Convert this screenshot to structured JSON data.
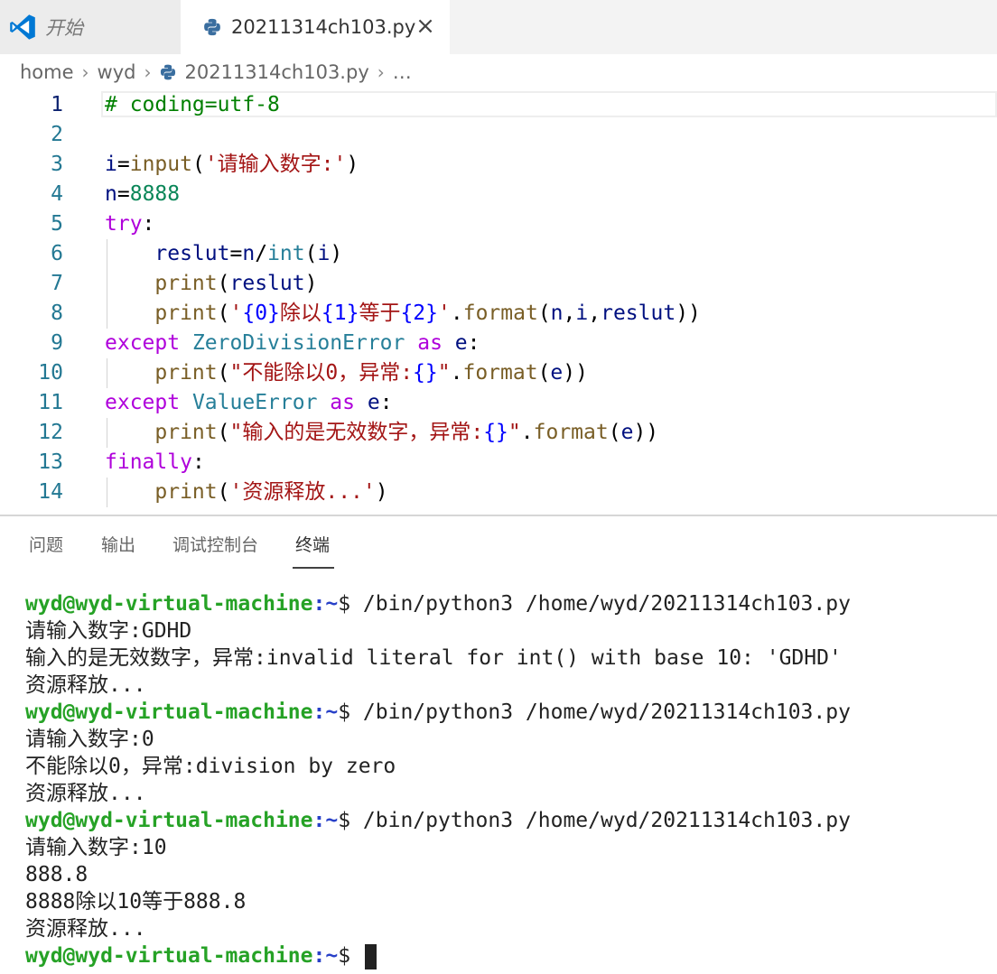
{
  "tabs": {
    "start_label": "开始",
    "file_label": "20211314ch103.py",
    "close_glyph": "×"
  },
  "breadcrumb": [
    "home",
    "wyd",
    "20211314ch103.py",
    "…"
  ],
  "editor": {
    "line_numbers": [
      "1",
      "2",
      "3",
      "4",
      "5",
      "6",
      "7",
      "8",
      "9",
      "10",
      "11",
      "12",
      "13",
      "14"
    ],
    "active_line": "1",
    "lines": [
      [
        {
          "t": "# coding=utf-8",
          "c": "cmt"
        }
      ],
      [],
      [
        {
          "t": "i",
          "c": "var"
        },
        {
          "t": "=",
          "c": "plain"
        },
        {
          "t": "input",
          "c": "fn"
        },
        {
          "t": "(",
          "c": "plain"
        },
        {
          "t": "'请输入数字:'",
          "c": "str"
        },
        {
          "t": ")",
          "c": "plain"
        }
      ],
      [
        {
          "t": "n",
          "c": "var"
        },
        {
          "t": "=",
          "c": "plain"
        },
        {
          "t": "8888",
          "c": "num"
        }
      ],
      [
        {
          "t": "try",
          "c": "kw"
        },
        {
          "t": ":",
          "c": "plain"
        }
      ],
      [
        {
          "t": "    ",
          "c": "plain"
        },
        {
          "t": "reslut",
          "c": "var"
        },
        {
          "t": "=",
          "c": "plain"
        },
        {
          "t": "n",
          "c": "var"
        },
        {
          "t": "/",
          "c": "plain"
        },
        {
          "t": "int",
          "c": "type"
        },
        {
          "t": "(",
          "c": "plain"
        },
        {
          "t": "i",
          "c": "var"
        },
        {
          "t": ")",
          "c": "plain"
        }
      ],
      [
        {
          "t": "    ",
          "c": "plain"
        },
        {
          "t": "print",
          "c": "fn"
        },
        {
          "t": "(",
          "c": "plain"
        },
        {
          "t": "reslut",
          "c": "var"
        },
        {
          "t": ")",
          "c": "plain"
        }
      ],
      [
        {
          "t": "    ",
          "c": "plain"
        },
        {
          "t": "print",
          "c": "fn"
        },
        {
          "t": "(",
          "c": "plain"
        },
        {
          "t": "'",
          "c": "str"
        },
        {
          "t": "{0}",
          "c": "brace"
        },
        {
          "t": "除以",
          "c": "str"
        },
        {
          "t": "{1}",
          "c": "brace"
        },
        {
          "t": "等于",
          "c": "str"
        },
        {
          "t": "{2}",
          "c": "brace"
        },
        {
          "t": "'",
          "c": "str"
        },
        {
          "t": ".",
          "c": "plain"
        },
        {
          "t": "format",
          "c": "fn"
        },
        {
          "t": "(",
          "c": "plain"
        },
        {
          "t": "n",
          "c": "var"
        },
        {
          "t": ",",
          "c": "plain"
        },
        {
          "t": "i",
          "c": "var"
        },
        {
          "t": ",",
          "c": "plain"
        },
        {
          "t": "reslut",
          "c": "var"
        },
        {
          "t": "))",
          "c": "plain"
        }
      ],
      [
        {
          "t": "except",
          "c": "kw"
        },
        {
          "t": " ",
          "c": "plain"
        },
        {
          "t": "ZeroDivisionError",
          "c": "type"
        },
        {
          "t": " ",
          "c": "plain"
        },
        {
          "t": "as",
          "c": "kw"
        },
        {
          "t": " ",
          "c": "plain"
        },
        {
          "t": "e",
          "c": "var"
        },
        {
          "t": ":",
          "c": "plain"
        }
      ],
      [
        {
          "t": "    ",
          "c": "plain"
        },
        {
          "t": "print",
          "c": "fn"
        },
        {
          "t": "(",
          "c": "plain"
        },
        {
          "t": "\"不能除以0，异常:",
          "c": "str"
        },
        {
          "t": "{}",
          "c": "brace"
        },
        {
          "t": "\"",
          "c": "str"
        },
        {
          "t": ".",
          "c": "plain"
        },
        {
          "t": "format",
          "c": "fn"
        },
        {
          "t": "(",
          "c": "plain"
        },
        {
          "t": "e",
          "c": "var"
        },
        {
          "t": "))",
          "c": "plain"
        }
      ],
      [
        {
          "t": "except",
          "c": "kw"
        },
        {
          "t": " ",
          "c": "plain"
        },
        {
          "t": "ValueError",
          "c": "type"
        },
        {
          "t": " ",
          "c": "plain"
        },
        {
          "t": "as",
          "c": "kw"
        },
        {
          "t": " ",
          "c": "plain"
        },
        {
          "t": "e",
          "c": "var"
        },
        {
          "t": ":",
          "c": "plain"
        }
      ],
      [
        {
          "t": "    ",
          "c": "plain"
        },
        {
          "t": "print",
          "c": "fn"
        },
        {
          "t": "(",
          "c": "plain"
        },
        {
          "t": "\"输入的是无效数字，异常:",
          "c": "str"
        },
        {
          "t": "{}",
          "c": "brace"
        },
        {
          "t": "\"",
          "c": "str"
        },
        {
          "t": ".",
          "c": "plain"
        },
        {
          "t": "format",
          "c": "fn"
        },
        {
          "t": "(",
          "c": "plain"
        },
        {
          "t": "e",
          "c": "var"
        },
        {
          "t": "))",
          "c": "plain"
        }
      ],
      [
        {
          "t": "finally",
          "c": "kw"
        },
        {
          "t": ":",
          "c": "plain"
        }
      ],
      [
        {
          "t": "    ",
          "c": "plain"
        },
        {
          "t": "print",
          "c": "fn"
        },
        {
          "t": "(",
          "c": "plain"
        },
        {
          "t": "'资源释放...'",
          "c": "str"
        },
        {
          "t": ")",
          "c": "plain"
        }
      ]
    ]
  },
  "panel": {
    "tabs": [
      "问题",
      "输出",
      "调试控制台",
      "终端"
    ],
    "active_tab": "终端"
  },
  "terminal": {
    "prompt_user": "wyd@wyd-virtual-machine",
    "prompt_path": ":~",
    "lines": [
      {
        "prompt": true,
        "text": "$ /bin/python3 /home/wyd/20211314ch103.py"
      },
      {
        "prompt": false,
        "text": "请输入数字:GDHD"
      },
      {
        "prompt": false,
        "text": "输入的是无效数字，异常:invalid literal for int() with base 10: 'GDHD'"
      },
      {
        "prompt": false,
        "text": "资源释放..."
      },
      {
        "prompt": true,
        "text": "$ /bin/python3 /home/wyd/20211314ch103.py"
      },
      {
        "prompt": false,
        "text": "请输入数字:0"
      },
      {
        "prompt": false,
        "text": "不能除以0，异常:division by zero"
      },
      {
        "prompt": false,
        "text": "资源释放..."
      },
      {
        "prompt": true,
        "text": "$ /bin/python3 /home/wyd/20211314ch103.py"
      },
      {
        "prompt": false,
        "text": "请输入数字:10"
      },
      {
        "prompt": false,
        "text": "888.8"
      },
      {
        "prompt": false,
        "text": "8888除以10等于888.8"
      },
      {
        "prompt": false,
        "text": "资源释放..."
      },
      {
        "prompt": true,
        "text": "$ ",
        "cursor": true
      }
    ]
  },
  "colors": {
    "accent": "#0066b8",
    "terminal_user": "#26a226",
    "terminal_path": "#2840c8"
  }
}
